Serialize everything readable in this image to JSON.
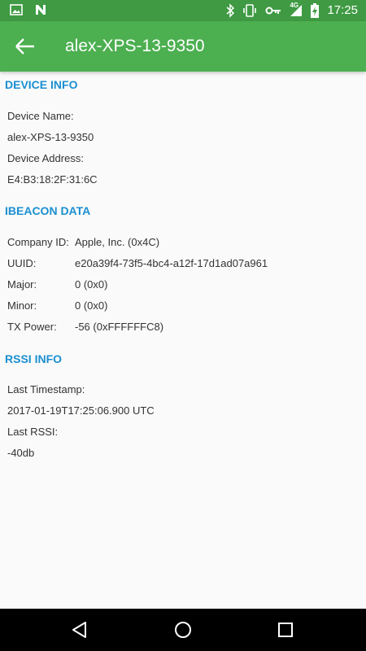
{
  "status_bar": {
    "time": "17:25",
    "left_icons": [
      "image-icon",
      "n-notification-icon"
    ],
    "right_icons": [
      "bluetooth-icon",
      "vibrate-icon",
      "key-icon",
      "signal-4g-icon",
      "battery-charging-icon"
    ],
    "signal_label": "4G"
  },
  "app_bar": {
    "title": "alex-XPS-13-9350",
    "back_icon": "arrow-back-icon",
    "color": "#4caf50"
  },
  "device_info": {
    "section_title": "DEVICE INFO",
    "name_label": "Device Name:",
    "name_value": "alex-XPS-13-9350",
    "address_label": "Device Address:",
    "address_value": "E4:B3:18:2F:31:6C"
  },
  "ibeacon_data": {
    "section_title": "IBEACON DATA",
    "rows": [
      {
        "label": "Company ID:",
        "value": "Apple, Inc. (0x4C)"
      },
      {
        "label": "UUID:",
        "value": "e20a39f4-73f5-4bc4-a12f-17d1ad07a961"
      },
      {
        "label": "Major:",
        "value": "0 (0x0)"
      },
      {
        "label": "Minor:",
        "value": "0 (0x0)"
      },
      {
        "label": "TX Power:",
        "value": "-56 (0xFFFFFFC8)"
      }
    ]
  },
  "rssi_info": {
    "section_title": "RSSI INFO",
    "timestamp_label": "Last Timestamp:",
    "timestamp_value": "2017-01-19T17:25:06.900 UTC",
    "rssi_label": "Last RSSI:",
    "rssi_value": "-40db"
  },
  "nav_bar": {
    "buttons": [
      "back-triangle-icon",
      "home-circle-icon",
      "recents-square-icon"
    ]
  },
  "colors": {
    "status_bar": "#3f9a43",
    "accent": "#1a8fd1"
  }
}
